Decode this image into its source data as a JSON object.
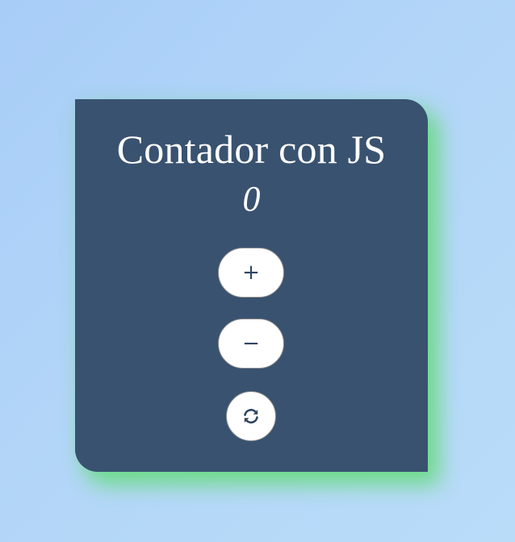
{
  "counter": {
    "title": "Contador con JS",
    "value": "0"
  },
  "buttons": {
    "increment_label": "+",
    "decrement_label": "−",
    "reset_icon": "refresh-icon"
  },
  "colors": {
    "background": "#b3d6f8",
    "card": "#395270",
    "card_glow": "#60db76",
    "button_bg": "#ffffff",
    "button_text": "#2f4560"
  }
}
